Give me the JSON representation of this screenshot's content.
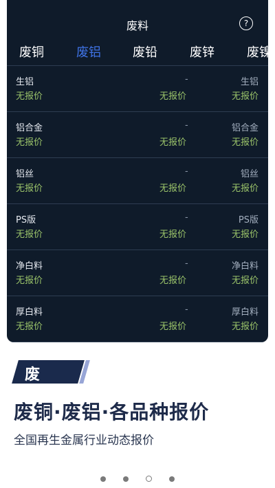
{
  "header": {
    "title": "废料",
    "help_glyph": "?"
  },
  "tabs": [
    {
      "label": "废铜",
      "active": false
    },
    {
      "label": "废铝",
      "active": true
    },
    {
      "label": "废铅",
      "active": false
    },
    {
      "label": "废锌",
      "active": false
    },
    {
      "label": "废镍",
      "active": false
    }
  ],
  "rows": [
    {
      "name": "生铝",
      "price": "无报价",
      "dash": "-",
      "mid_price": "无报价",
      "right_name": "生铝",
      "right_price": "无报价"
    },
    {
      "name": "铝合金",
      "price": "无报价",
      "dash": "-",
      "mid_price": "无报价",
      "right_name": "铝合金",
      "right_price": "无报价"
    },
    {
      "name": "铝丝",
      "price": "无报价",
      "dash": "-",
      "mid_price": "无报价",
      "right_name": "铝丝",
      "right_price": "无报价"
    },
    {
      "name": "PS版",
      "price": "无报价",
      "dash": "-",
      "mid_price": "无报价",
      "right_name": "PS版",
      "right_price": "无报价"
    },
    {
      "name": "净白料",
      "price": "无报价",
      "dash": "-",
      "mid_price": "无报价",
      "right_name": "净白料",
      "right_price": "无报价"
    },
    {
      "name": "厚白料",
      "price": "无报价",
      "dash": "-",
      "mid_price": "无报价",
      "right_name": "厚白料",
      "right_price": "无报价"
    }
  ],
  "promo": {
    "badge": "废料",
    "headline": "废铜·废铝·各品种报价",
    "subline": "全国再生金属行业动态报价"
  },
  "pager": {
    "count": 4,
    "active_index": 2
  },
  "colors": {
    "bg": "#0f1b2a",
    "active_tab": "#3f73e6",
    "price": "#9bc46a",
    "badge": "#1a2a4c"
  }
}
